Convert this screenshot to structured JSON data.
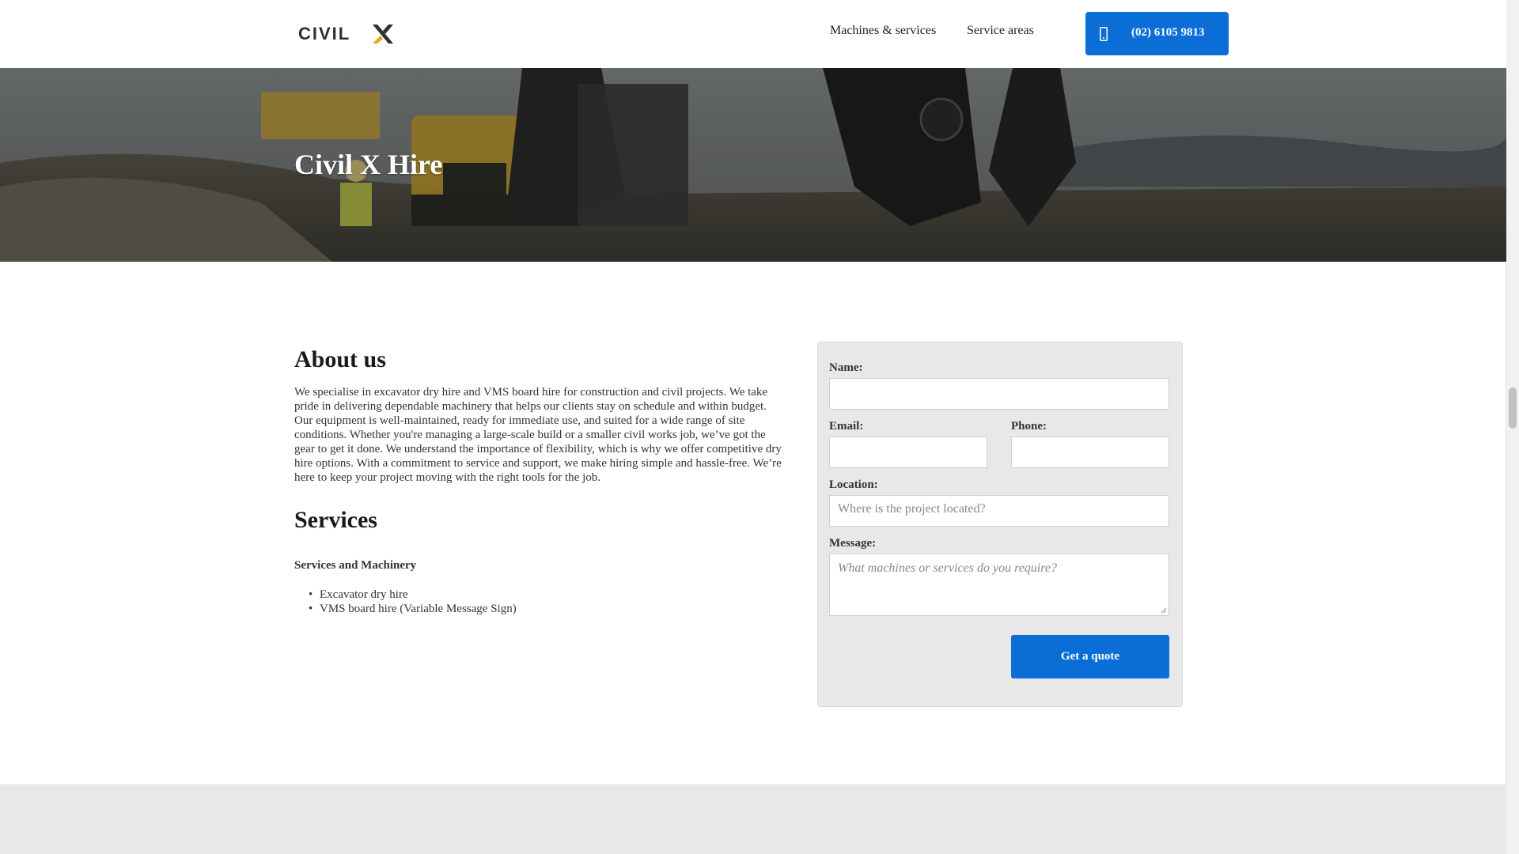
{
  "header": {
    "logo_text": "CIVIL",
    "logo_mark": "X",
    "nav": [
      "Machines & services",
      "Service areas"
    ],
    "phone_label": "(02) 6105 9813",
    "phone_icon": "phone-icon"
  },
  "hero": {
    "title": "Civil X Hire"
  },
  "about": {
    "heading": "About us",
    "body": "We specialise in excavator dry hire and VMS board hire for construction and civil projects. We take pride in delivering dependable machinery that helps our clients stay on schedule and within budget. Our equipment is well-maintained, ready for immediate use, and suited for a wide range of site conditions. Whether you're managing a large-scale build or a smaller civil works job, we’ve got the gear to get it done. We understand the importance of flexibility, which is why we offer competitive dry hire options. With a commitment to service and support, we make hiring simple and hassle-free. We’re here to keep your project moving with the right tools for the job."
  },
  "services": {
    "heading": "Services",
    "subheading": "Services and Machinery",
    "items": [
      "Excavator dry hire",
      "VMS board hire (Variable Message Sign)"
    ]
  },
  "form": {
    "name_label": "Name:",
    "name_value": "",
    "email_label": "Email:",
    "email_value": "",
    "phone_label": "Phone:",
    "phone_value": "",
    "location_label": "Location:",
    "location_placeholder": "Where is the project located?",
    "message_label": "Message:",
    "message_placeholder": "What machines or services do you require?",
    "submit_label": "Get a quote"
  },
  "colors": {
    "accent": "#0b6ed6",
    "logo_orange": "#f0a21a",
    "form_bg": "#e8e8e8"
  }
}
